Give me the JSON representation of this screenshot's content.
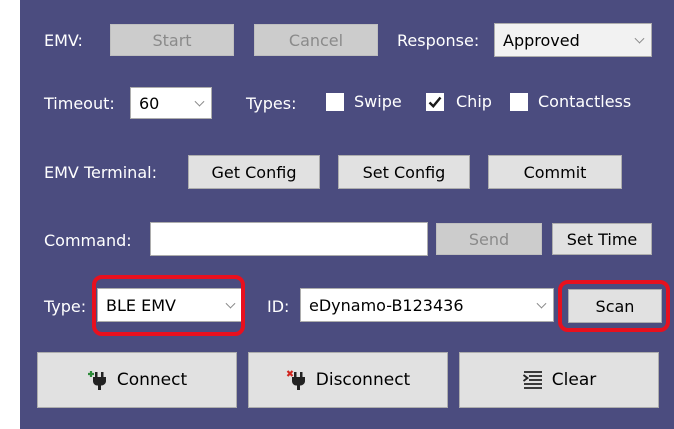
{
  "emv_row": {
    "label": "EMV:",
    "start_label": "Start",
    "cancel_label": "Cancel",
    "response_label": "Response:",
    "response_value": "Approved"
  },
  "timeout_row": {
    "timeout_label": "Timeout:",
    "timeout_value": "60",
    "types_label": "Types:",
    "swipe_label": "Swipe",
    "swipe_checked": false,
    "chip_label": "Chip",
    "chip_checked": true,
    "contactless_label": "Contactless",
    "contactless_checked": false
  },
  "terminal_row": {
    "label": "EMV Terminal:",
    "get_config_label": "Get Config",
    "set_config_label": "Set Config",
    "commit_label": "Commit"
  },
  "command_row": {
    "label": "Command:",
    "command_value": "",
    "send_label": "Send",
    "set_time_label": "Set Time"
  },
  "device_row": {
    "type_label": "Type:",
    "type_value": "BLE EMV",
    "id_label": "ID:",
    "id_value": "eDynamo-B123436",
    "scan_label": "Scan"
  },
  "actions": {
    "connect_label": "Connect",
    "disconnect_label": "Disconnect",
    "clear_label": "Clear"
  },
  "colors": {
    "panel_background": "#4b4c7f",
    "highlight": "#e8101e",
    "connect_icon_accent": "#2e8b3a",
    "disconnect_icon_accent": "#d0261f"
  }
}
